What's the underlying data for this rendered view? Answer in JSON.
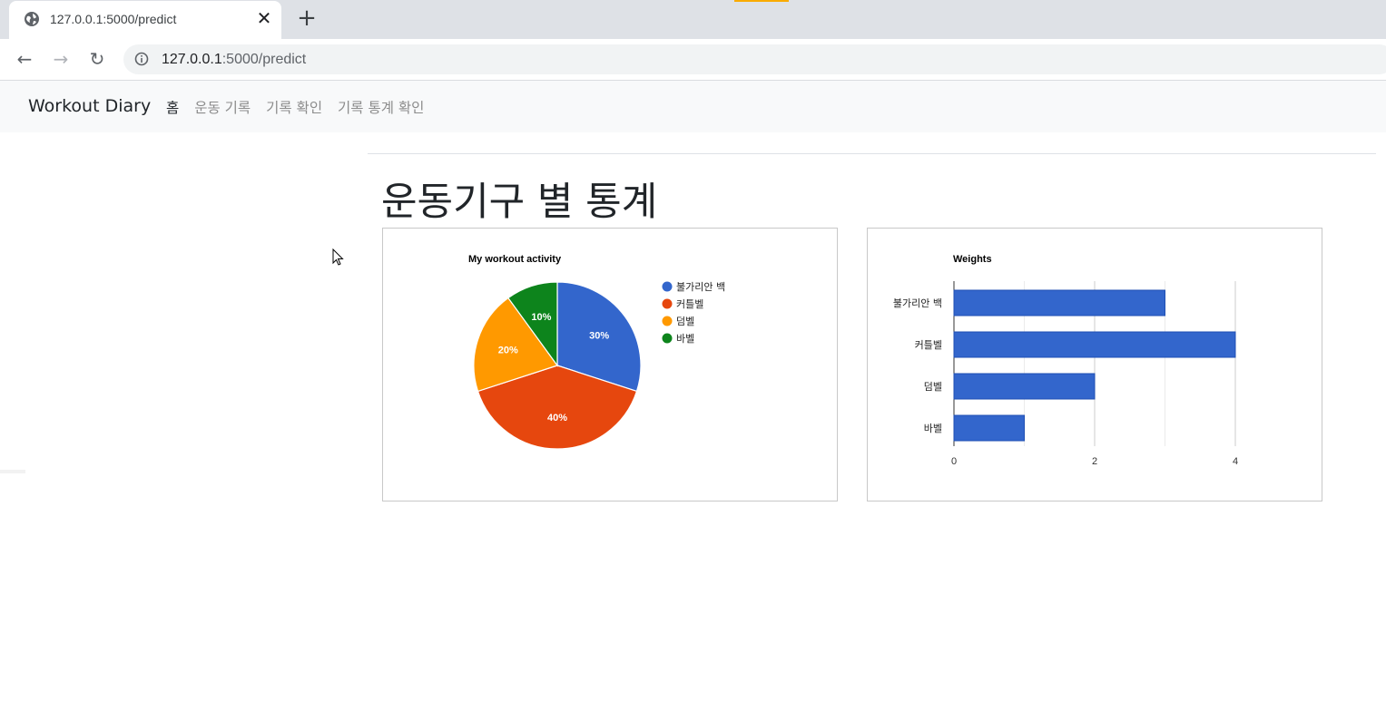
{
  "browser": {
    "tab_title": "127.0.0.1:5000/predict",
    "url_host": "127.0.0.1",
    "url_path": ":5000/predict",
    "icons": {
      "tab": "globe-icon",
      "close": "close-icon",
      "new_tab": "plus-icon",
      "back": "back-arrow-icon",
      "forward": "forward-arrow-icon",
      "reload": "reload-icon",
      "site_info": "info-icon"
    }
  },
  "navbar": {
    "brand": "Workout Diary",
    "links": [
      "홈",
      "운동 기록",
      "기록 확인",
      "기록 통계 확인"
    ],
    "active_index": 0
  },
  "page": {
    "heading": "운동기구 별 통계"
  },
  "chart_data": [
    {
      "type": "pie",
      "title": "My workout activity",
      "categories": [
        "불가리안 백",
        "커틀벨",
        "덤벨",
        "바벨"
      ],
      "values": [
        30,
        40,
        20,
        10
      ],
      "labels": [
        "30%",
        "40%",
        "20%",
        "10%"
      ],
      "colors": [
        "#3366cc",
        "#e6470e",
        "#ff9900",
        "#0d841c"
      ],
      "legend": "right"
    },
    {
      "type": "bar",
      "orientation": "horizontal",
      "title": "Weights",
      "categories": [
        "불가리안 백",
        "커틀벨",
        "덤벨",
        "바벨"
      ],
      "values": [
        3,
        4,
        2,
        1
      ],
      "xticks": [
        "0",
        "2",
        "4"
      ],
      "xlim": [
        0,
        4
      ],
      "color": "#3366cc",
      "grid": true
    }
  ]
}
